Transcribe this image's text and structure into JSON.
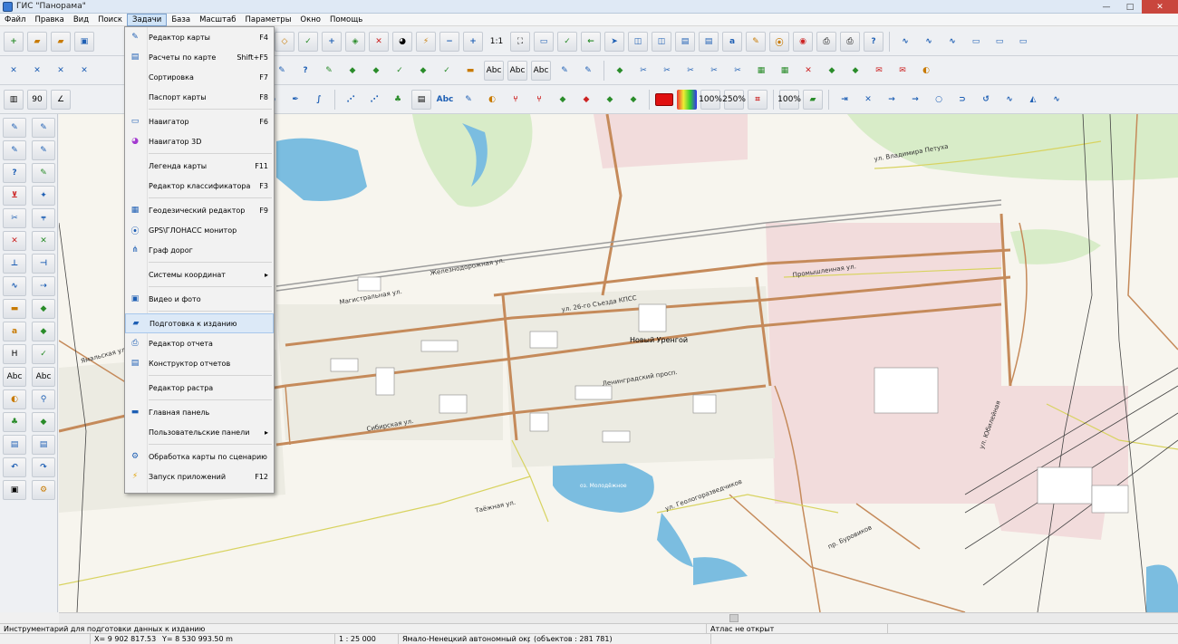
{
  "window": {
    "title": "ГИС \"Панорама\"",
    "minimize": "—",
    "maximize": "□",
    "close": "✕"
  },
  "menubar": [
    "Файл",
    "Правка",
    "Вид",
    "Поиск",
    "Задачи",
    "База",
    "Масштаб",
    "Параметры",
    "Окно",
    "Помощь"
  ],
  "tasks_menu": [
    {
      "label": "Редактор карты",
      "shortcut": "F4",
      "icon": "pencil-icon"
    },
    {
      "label": "Расчеты по карте",
      "shortcut": "Shift+F5",
      "icon": "calc-icon"
    },
    {
      "label": "Сортировка",
      "shortcut": "F7",
      "icon": "sort-icon"
    },
    {
      "label": "Паспорт карты",
      "shortcut": "F8",
      "icon": "passport-icon"
    },
    {
      "label": "Навигатор",
      "shortcut": "F6",
      "icon": "navigator-icon"
    },
    {
      "label": "Навигатор 3D",
      "shortcut": "",
      "icon": "navigator-3d-icon"
    },
    {
      "label": "Легенда карты",
      "shortcut": "F11",
      "icon": "legend-icon"
    },
    {
      "label": "Редактор классификатора",
      "shortcut": "F3",
      "icon": "classifier-icon"
    },
    {
      "label": "Геодезический редактор",
      "shortcut": "F9",
      "icon": "geodesic-icon"
    },
    {
      "label": "GPS\\ГЛОНАСС монитор",
      "shortcut": "",
      "icon": "gps-icon"
    },
    {
      "label": "Граф дорог",
      "shortcut": "",
      "icon": "graph-icon"
    },
    {
      "label": "Системы координат",
      "shortcut": "▸",
      "icon": ""
    },
    {
      "label": "Видео и фото",
      "shortcut": "",
      "icon": "video-icon"
    },
    {
      "label": "Подготовка к изданию",
      "shortcut": "",
      "icon": "print-prep-icon"
    },
    {
      "label": "Редактор отчета",
      "shortcut": "",
      "icon": "report-icon"
    },
    {
      "label": "Конструктор отчетов",
      "shortcut": "",
      "icon": "report-builder-icon"
    },
    {
      "label": "Редактор растра",
      "shortcut": "",
      "icon": "raster-icon"
    },
    {
      "label": "Главная панель",
      "shortcut": "",
      "icon": "panel-icon"
    },
    {
      "label": "Пользовательские панели",
      "shortcut": "▸",
      "icon": ""
    },
    {
      "label": "Обработка карты по сценарию",
      "shortcut": "",
      "icon": "script-icon"
    },
    {
      "label": "Запуск приложений",
      "shortcut": "F12",
      "icon": "lightning-icon"
    }
  ],
  "toolbar1_labels": {
    "scale_1_1": "1:1",
    "zoom_100": "100%",
    "zoom_250": "250%"
  },
  "toolbar_text_icons": {
    "abc": "Abc"
  },
  "map_labels": [
    {
      "text": "ул. Владимира Петуха"
    },
    {
      "text": "Железнодорожная ул."
    },
    {
      "text": "Магистральная ул."
    },
    {
      "text": "ул. 26-го Съезда КПСС"
    },
    {
      "text": "Новый Уренгой"
    },
    {
      "text": "Промышленная ул."
    },
    {
      "text": "Ленинградский просп."
    },
    {
      "text": "Сибирская ул."
    },
    {
      "text": "Таёжная ул."
    },
    {
      "text": "оз. Молодёжное"
    },
    {
      "text": "ул. Геологоразведчиков"
    },
    {
      "text": "пр. Буровиков"
    },
    {
      "text": "Ямальская ул."
    },
    {
      "text": "ул. Юбилейная"
    }
  ],
  "status": {
    "hint": "Инструментарий для подготовки данных к изданию",
    "atlas": "Атлас не открыт",
    "x": "X= 9 902 817.53 m",
    "y": "Y= 8 530 993.50 m",
    "scale": "1 : 25 000",
    "region": "Ямало-Ненецкий автономный округ",
    "objects": "(объектов : 281 781)"
  }
}
